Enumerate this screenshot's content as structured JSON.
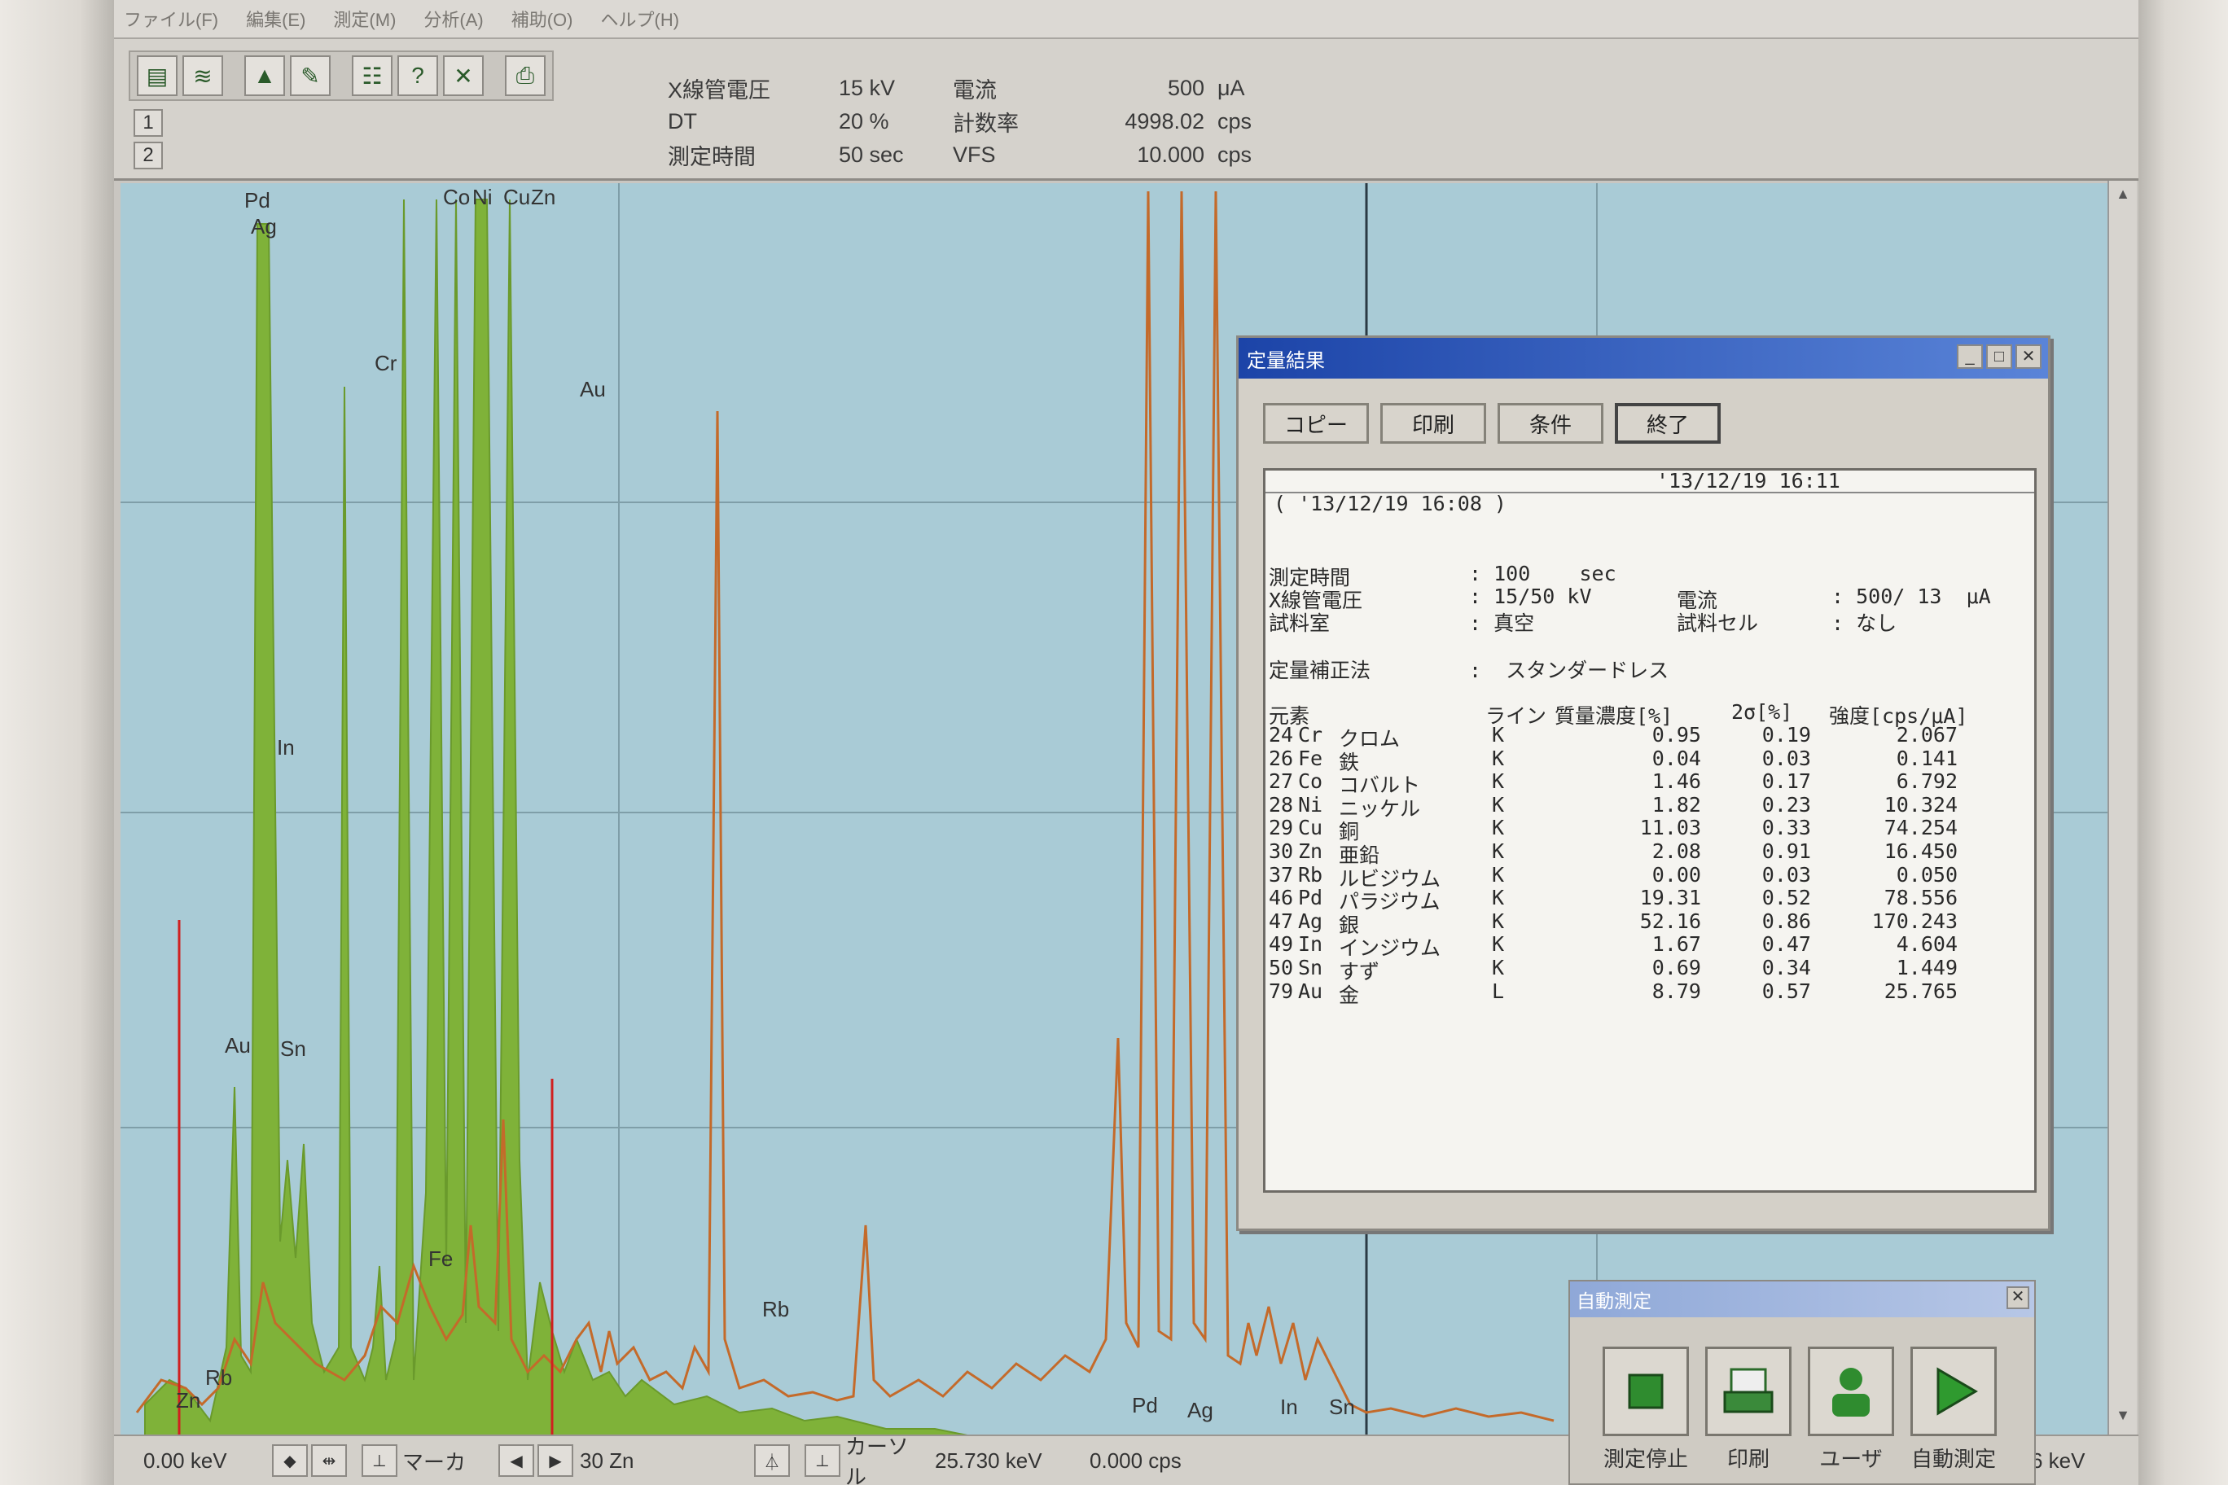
{
  "menu": [
    "ファイル(F)",
    "編集(E)",
    "測定(M)",
    "分析(A)",
    "補助(O)",
    "ヘルプ(H)"
  ],
  "toolbar": {
    "icons": [
      "spectrum-list-icon",
      "spectrum-overlay-icon",
      "graph-icon",
      "edit-graph-icon",
      "table-icon",
      "help-icon",
      "cancel-icon",
      "print-icon"
    ],
    "traces": [
      "1",
      "2"
    ]
  },
  "info": {
    "row1": {
      "label": "X線管電圧",
      "value": "15 kV",
      "label2": "電流",
      "value2": "500",
      "unit2": "μA"
    },
    "row2": {
      "label": "DT",
      "value": "20 %",
      "label2": "計数率",
      "value2": "4998.02",
      "unit2": "cps"
    },
    "row3": {
      "label": "測定時間",
      "value": "50 sec",
      "label2": "VFS",
      "value2": "10.000",
      "unit2": "cps"
    }
  },
  "spectrum": {
    "labels": {
      "pd": "Pd",
      "ag": "Ag",
      "co": "Co",
      "ni": "Ni",
      "cu": "Cu",
      "zn": "Zn",
      "cr": "Cr",
      "au": "Au",
      "in": "In",
      "sn": "Sn",
      "fe": "Fe",
      "rb": "Rb",
      "zn2": "Zn"
    },
    "colors": {
      "bg": "#a9cbd6",
      "fill": "#7fb239",
      "line": "#c46a2a",
      "marker": "#d02020"
    }
  },
  "quant": {
    "title": "定量結果",
    "buttons": {
      "copy": "コピー",
      "print": "印刷",
      "cond": "条件",
      "end": "終了"
    },
    "datetime_now": "'13/12/19 16:11",
    "datetime_meas": "( '13/12/19 16:08 )",
    "meas_time_label": "測定時間",
    "meas_time_value": ": 100    sec",
    "voltage_label": "X線管電圧",
    "voltage_value": ": 15/50 kV",
    "current_label": "電流",
    "current_value": ": 500/ 13  μA",
    "room_label": "試料室",
    "room_value": ": 真空",
    "cell_label": "試料セル",
    "cell_value": ": なし",
    "method_label": "定量補正法",
    "method_value": ":  スタンダードレス",
    "table_header": {
      "element": "元素",
      "line": "ライン",
      "conc": "質量濃度[%]",
      "sigma": "2σ[%]",
      "intensity": "強度[cps/μA]"
    },
    "rows": [
      {
        "z": "24",
        "sym": "Cr",
        "name": "クロム",
        "line": "K",
        "conc": "0.95",
        "sigma": "0.19",
        "int": "2.067"
      },
      {
        "z": "26",
        "sym": "Fe",
        "name": "鉄",
        "line": "K",
        "conc": "0.04",
        "sigma": "0.03",
        "int": "0.141"
      },
      {
        "z": "27",
        "sym": "Co",
        "name": "コバルト",
        "line": "K",
        "conc": "1.46",
        "sigma": "0.17",
        "int": "6.792"
      },
      {
        "z": "28",
        "sym": "Ni",
        "name": "ニッケル",
        "line": "K",
        "conc": "1.82",
        "sigma": "0.23",
        "int": "10.324"
      },
      {
        "z": "29",
        "sym": "Cu",
        "name": "銅",
        "line": "K",
        "conc": "11.03",
        "sigma": "0.33",
        "int": "74.254"
      },
      {
        "z": "30",
        "sym": "Zn",
        "name": "亜鉛",
        "line": "K",
        "conc": "2.08",
        "sigma": "0.91",
        "int": "16.450"
      },
      {
        "z": "37",
        "sym": "Rb",
        "name": "ルビジウム",
        "line": "K",
        "conc": "0.00",
        "sigma": "0.03",
        "int": "0.050"
      },
      {
        "z": "46",
        "sym": "Pd",
        "name": "パラジウム",
        "line": "K",
        "conc": "19.31",
        "sigma": "0.52",
        "int": "78.556"
      },
      {
        "z": "47",
        "sym": "Ag",
        "name": "銀",
        "line": "K",
        "conc": "52.16",
        "sigma": "0.86",
        "int": "170.243"
      },
      {
        "z": "49",
        "sym": "In",
        "name": "インジウム",
        "line": "K",
        "conc": "1.67",
        "sigma": "0.47",
        "int": "4.604"
      },
      {
        "z": "50",
        "sym": "Sn",
        "name": "すず",
        "line": "K",
        "conc": "0.69",
        "sigma": "0.34",
        "int": "1.449"
      },
      {
        "z": "79",
        "sym": "Au",
        "name": "金",
        "line": "L",
        "conc": "8.79",
        "sigma": "0.57",
        "int": "25.765"
      }
    ]
  },
  "auto": {
    "title": "自動測定",
    "buttons": [
      {
        "label": "測定停止",
        "icon": "stop-icon"
      },
      {
        "label": "印刷",
        "icon": "printer-icon"
      },
      {
        "label": "ユーザ",
        "icon": "user-icon"
      },
      {
        "label": "自動測定",
        "icon": "play-icon"
      }
    ]
  },
  "status": {
    "start_kev": "0.00 keV",
    "marker_label": "マーカ",
    "marker_value": "30 Zn",
    "cursor_label": "カーソル",
    "cursor_kev": "25.730 keV",
    "cursor_cps": "0.000 cps",
    "end_kev": "6 keV"
  }
}
